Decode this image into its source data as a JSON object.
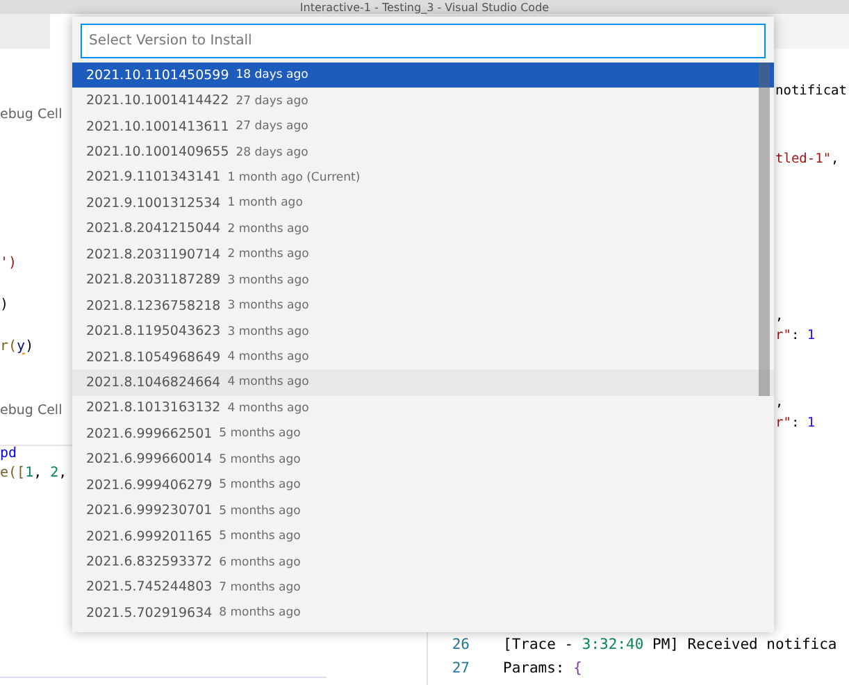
{
  "window": {
    "title": "Interactive-1 - Testing_3 - Visual Studio Code"
  },
  "left_editor": [
    {
      "kind": "toolbar",
      "segments": [
        {
          "text": "ebug Cell",
          "color": "#616161"
        }
      ]
    },
    {
      "kind": "code",
      "segments": [
        {
          "text": "')",
          "color": "#a31515"
        }
      ]
    },
    {
      "kind": "code",
      "segments": [
        {
          "text": ")",
          "color": "#000000"
        }
      ]
    },
    {
      "kind": "code",
      "segments": [
        {
          "text": "r(",
          "color": "#795e26"
        },
        {
          "text": "y",
          "color": "#001080",
          "underlined": true
        },
        {
          "text": ")",
          "color": "#000000"
        }
      ]
    },
    {
      "kind": "toolbar",
      "segments": [
        {
          "text": "ebug Cell",
          "color": "#616161"
        }
      ]
    },
    {
      "kind": "code",
      "segments": [
        {
          "text": "pd",
          "color": "#0000ff"
        }
      ]
    },
    {
      "kind": "code",
      "segments": [
        {
          "text": "e([",
          "color": "#795e26"
        },
        {
          "text": "1",
          "color": "#098658"
        },
        {
          "text": ", ",
          "color": "#000000"
        },
        {
          "text": "2",
          "color": "#098658"
        },
        {
          "text": ",",
          "color": "#000000"
        }
      ]
    }
  ],
  "output_panel": {
    "fragments": [
      {
        "segments": [
          {
            "text": "notificat",
            "color": "#000000"
          }
        ]
      },
      {
        "segments": [
          {
            "text": "tled-1\"",
            "color": "#a31515"
          },
          {
            "text": ",",
            "color": "#000000"
          }
        ]
      },
      {
        "segments": [
          {
            "text": ",",
            "color": "#000000"
          }
        ]
      },
      {
        "segments": [
          {
            "text": "r\"",
            "color": "#a31515"
          },
          {
            "text": ": ",
            "color": "#000000"
          },
          {
            "text": "1",
            "color": "#3100ff"
          }
        ]
      },
      {
        "segments": [
          {
            "text": ",",
            "color": "#000000"
          }
        ]
      },
      {
        "segments": [
          {
            "text": "r\"",
            "color": "#a31515"
          },
          {
            "text": ": ",
            "color": "#000000"
          },
          {
            "text": "1",
            "color": "#3100ff"
          }
        ]
      }
    ],
    "lines": [
      {
        "number": "26",
        "segments": [
          {
            "text": "[Trace - ",
            "color": "#000000"
          },
          {
            "text": "3:32:40",
            "color": "#098658"
          },
          {
            "text": " PM] Received notifica",
            "color": "#000000"
          }
        ]
      },
      {
        "number": "27",
        "segments": [
          {
            "text": "Params: ",
            "color": "#000000"
          },
          {
            "text": "{",
            "color": "#7a3e9d"
          }
        ]
      }
    ]
  },
  "quick_pick": {
    "placeholder": "Select Version to Install",
    "items": [
      {
        "label": "2021.10.1101450599",
        "description": "18 days ago",
        "selected": true,
        "hovered": false
      },
      {
        "label": "2021.10.1001414422",
        "description": "27 days ago",
        "selected": false,
        "hovered": false
      },
      {
        "label": "2021.10.1001413611",
        "description": "27 days ago",
        "selected": false,
        "hovered": false
      },
      {
        "label": "2021.10.1001409655",
        "description": "28 days ago",
        "selected": false,
        "hovered": false
      },
      {
        "label": "2021.9.1101343141",
        "description": "1 month ago (Current)",
        "selected": false,
        "hovered": false
      },
      {
        "label": "2021.9.1001312534",
        "description": "1 month ago",
        "selected": false,
        "hovered": false
      },
      {
        "label": "2021.8.2041215044",
        "description": "2 months ago",
        "selected": false,
        "hovered": false
      },
      {
        "label": "2021.8.2031190714",
        "description": "2 months ago",
        "selected": false,
        "hovered": false
      },
      {
        "label": "2021.8.2031187289",
        "description": "3 months ago",
        "selected": false,
        "hovered": false
      },
      {
        "label": "2021.8.1236758218",
        "description": "3 months ago",
        "selected": false,
        "hovered": false
      },
      {
        "label": "2021.8.1195043623",
        "description": "3 months ago",
        "selected": false,
        "hovered": false
      },
      {
        "label": "2021.8.1054968649",
        "description": "4 months ago",
        "selected": false,
        "hovered": false
      },
      {
        "label": "2021.8.1046824664",
        "description": "4 months ago",
        "selected": false,
        "hovered": true
      },
      {
        "label": "2021.8.1013163132",
        "description": "4 months ago",
        "selected": false,
        "hovered": false
      },
      {
        "label": "2021.6.999662501",
        "description": "5 months ago",
        "selected": false,
        "hovered": false
      },
      {
        "label": "2021.6.999660014",
        "description": "5 months ago",
        "selected": false,
        "hovered": false
      },
      {
        "label": "2021.6.999406279",
        "description": "5 months ago",
        "selected": false,
        "hovered": false
      },
      {
        "label": "2021.6.999230701",
        "description": "5 months ago",
        "selected": false,
        "hovered": false
      },
      {
        "label": "2021.6.999201165",
        "description": "5 months ago",
        "selected": false,
        "hovered": false
      },
      {
        "label": "2021.6.832593372",
        "description": "6 months ago",
        "selected": false,
        "hovered": false
      },
      {
        "label": "2021.5.745244803",
        "description": "7 months ago",
        "selected": false,
        "hovered": false
      },
      {
        "label": "2021.5.702919634",
        "description": "8 months ago",
        "selected": false,
        "hovered": false
      }
    ]
  }
}
